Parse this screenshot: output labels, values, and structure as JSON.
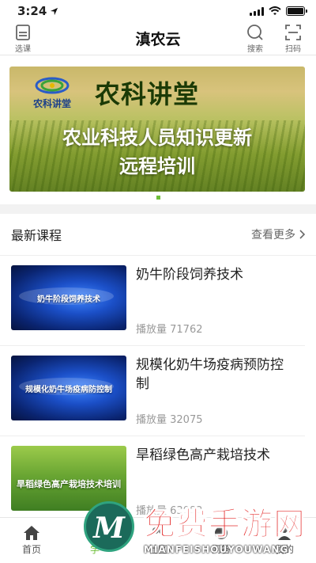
{
  "status_bar": {
    "time": "3:24"
  },
  "header": {
    "title": "滇农云",
    "left_button": "选课",
    "search_button": "搜索",
    "scan_button": "扫码"
  },
  "banner": {
    "logo_text": "农科讲堂",
    "heading": "农科讲堂",
    "line1": "农业科技人员知识更新",
    "line2": "远程培训"
  },
  "section": {
    "title": "最新课程",
    "more": "查看更多"
  },
  "courses": [
    {
      "thumb_text": "奶牛阶段饲养技术",
      "title": "奶牛阶段饲养技术",
      "plays": "播放量 71762"
    },
    {
      "thumb_text": "规模化奶牛场疫病防控制",
      "title": "规模化奶牛场疫病预防控制",
      "plays": "播放量 32075"
    },
    {
      "thumb_text": "旱稻绿色高产栽培技术培训",
      "title": "旱稻绿色高产栽培技术",
      "plays": "播放量 63082"
    }
  ],
  "tabs": [
    {
      "label": "首页",
      "icon": "home-icon"
    },
    {
      "label": "学",
      "icon": "study-icon"
    },
    {
      "label": "社区",
      "icon": "community-icon"
    },
    {
      "label": "问答",
      "icon": "qa-icon"
    },
    {
      "label": "我的",
      "icon": "profile-icon"
    }
  ],
  "watermark": {
    "title": "免费手游网",
    "subtitle": "MIANFEISHOUYOUWANG"
  },
  "colors": {
    "accent": "#6fbf3b",
    "text": "#222222",
    "muted": "#999999",
    "divider": "#eeeeee"
  }
}
